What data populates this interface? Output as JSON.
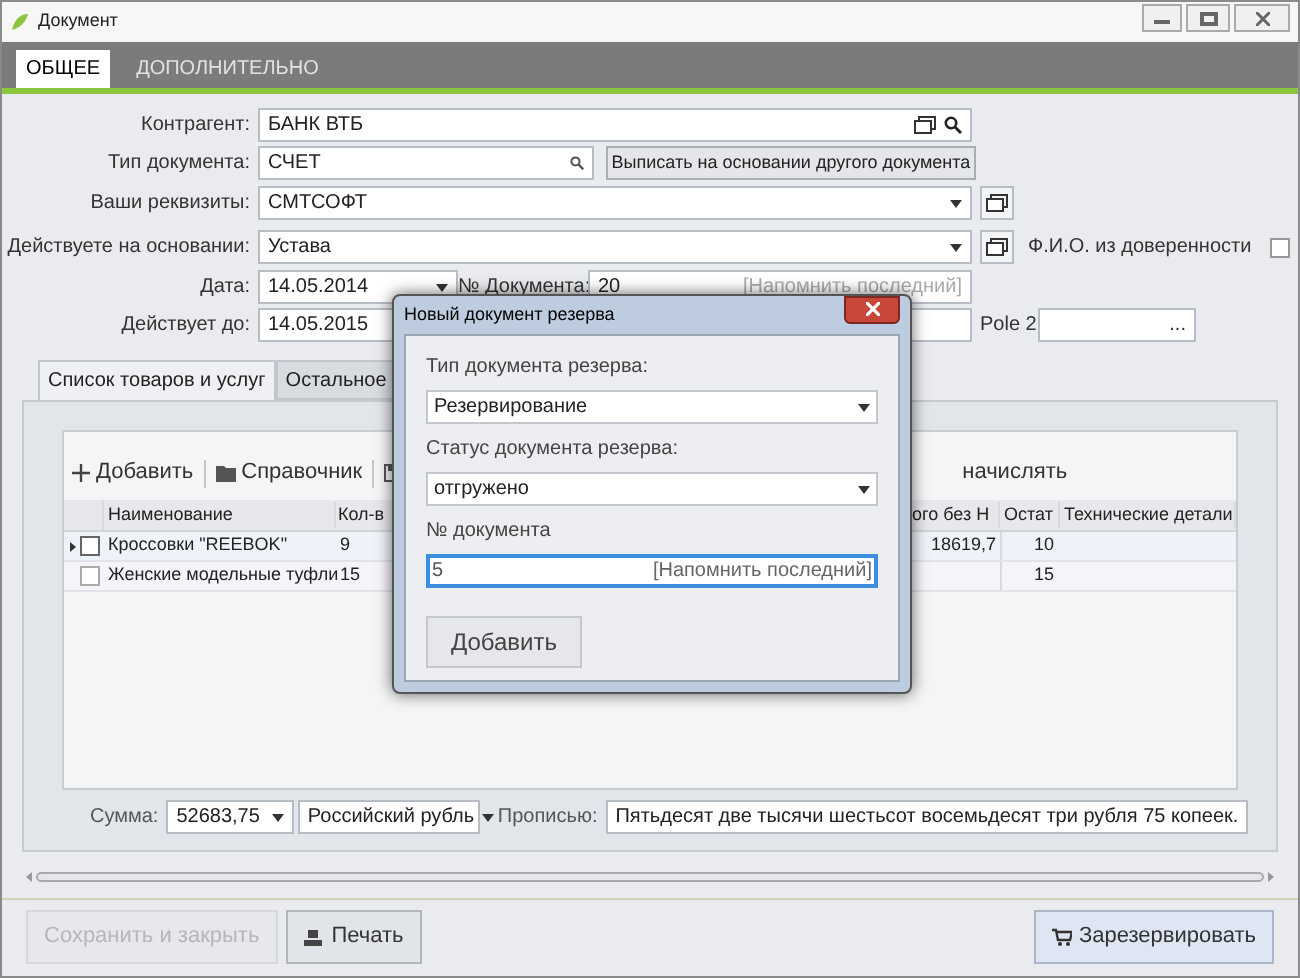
{
  "window": {
    "title": "Документ"
  },
  "tabs": [
    {
      "label": "ОБЩЕЕ",
      "selected": true
    },
    {
      "label": "ДОПОЛНИТЕЛЬНО",
      "selected": false
    }
  ],
  "form": {
    "counterparty": {
      "label": "Контрагент:",
      "value": "БАНК ВТБ"
    },
    "doc_type": {
      "label": "Тип документа:",
      "value": "СЧЕТ"
    },
    "based_on_button": "Выписать на основании другого документа",
    "requisites": {
      "label": "Ваши реквизиты:",
      "value": "СМТСОФТ"
    },
    "basis": {
      "label": "Действуете на основании:",
      "value": "Устава"
    },
    "proxy_name": {
      "label": "Ф.И.О. из доверенности",
      "checked": false
    },
    "date": {
      "label": "Дата:",
      "value": "14.05.2014"
    },
    "doc_number": {
      "label": "№ Документа:",
      "value": "20",
      "remind": "[Напомнить последний]"
    },
    "valid_until": {
      "label": "Действует до:",
      "value": "14.05.2015"
    },
    "pole2": {
      "label": "Pole 2",
      "button": "..."
    }
  },
  "inner_tabs": [
    {
      "label": "Список товаров и услуг",
      "selected": true
    },
    {
      "label": "Остальное",
      "selected": false
    }
  ],
  "toolbar": {
    "add": "Добавить",
    "catalog": "Справочник",
    "column_4": "начислять"
  },
  "table": {
    "columns": [
      "Наименование",
      "Кол-в",
      "ого без Н",
      "Остат",
      "Технические детали"
    ],
    "rows": [
      {
        "current": true,
        "checked": false,
        "name": "Кроссовки \"REEBOK\"",
        "qty": "9",
        "total": "18619,7",
        "stock": "10"
      },
      {
        "current": false,
        "checked": false,
        "name": "Женские модельные туфли",
        "qty": "15",
        "stock": "15"
      }
    ]
  },
  "summary": {
    "sum_label": "Сумма:",
    "sum": "52683,75",
    "currency": "Российский рубль",
    "words_label": "Прописью:",
    "words": "Пятьдесят две тысячи шестьсот восемьдесят три рубля 75 копеек."
  },
  "buttons": {
    "save": {
      "label": "Сохранить и закрыть",
      "disabled": true
    },
    "print": {
      "label": "Печать",
      "disabled": false
    },
    "reserve": {
      "label": "Зарезервировать",
      "disabled": false
    }
  },
  "dialog": {
    "title": "Новый документ резерва",
    "type": {
      "label": "Тип документа резерва:",
      "value": "Резервирование"
    },
    "status": {
      "label": "Статус документа резерва:",
      "value": "отгружено"
    },
    "number": {
      "label": "№ документа",
      "value": "5",
      "remind": "[Напомнить последний]"
    },
    "add_button": "Добавить"
  }
}
